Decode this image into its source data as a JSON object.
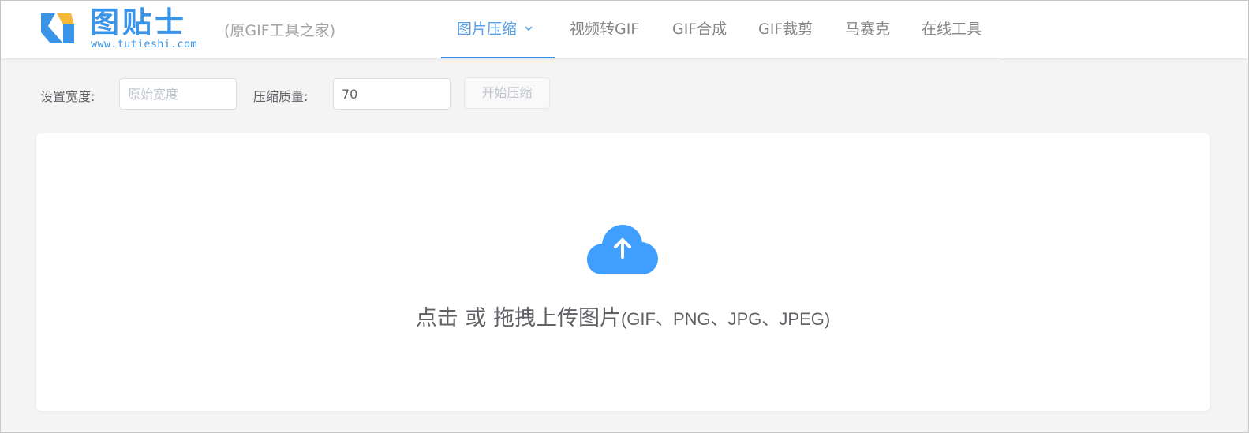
{
  "header": {
    "logo": {
      "title": "图贴士",
      "url": "www.tutieshi.com",
      "subtitle": "(原GIF工具之家)",
      "colors": {
        "brand_blue": "#3a95e8",
        "brand_yellow": "#f5b93a"
      }
    },
    "nav": [
      {
        "label": "图片压缩",
        "active": true,
        "has_dropdown": true
      },
      {
        "label": "视频转GIF",
        "active": false
      },
      {
        "label": "GIF合成",
        "active": false
      },
      {
        "label": "GIF裁剪",
        "active": false
      },
      {
        "label": "马赛克",
        "active": false
      },
      {
        "label": "在线工具",
        "active": false
      }
    ]
  },
  "toolbar": {
    "width_label": "设置宽度:",
    "width_placeholder": "原始宽度",
    "width_value": "",
    "quality_label": "压缩质量:",
    "quality_value": "70",
    "start_button": "开始压缩",
    "start_disabled": true
  },
  "upload": {
    "icon": "cloud-upload-icon",
    "text_main": "点击 或 拖拽上传图片",
    "text_formats": "(GIF、PNG、JPG、JPEG)",
    "accent": "#409eff"
  }
}
